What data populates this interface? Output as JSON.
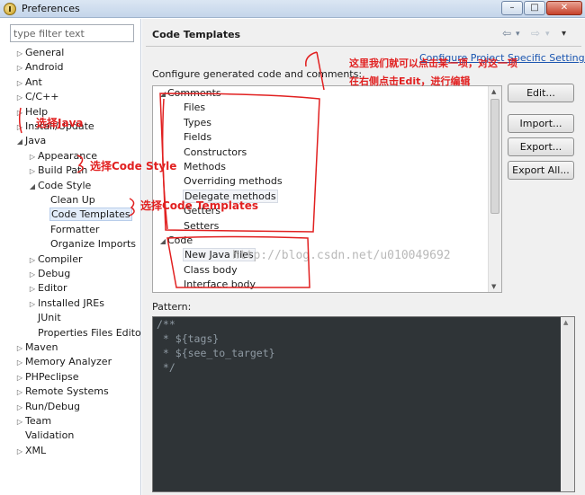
{
  "window": {
    "title": "Preferences",
    "min": "–",
    "max": "□",
    "close": "✕"
  },
  "left": {
    "filter_placeholder": "type filter text",
    "items": [
      {
        "label": "General",
        "arrow": "▷"
      },
      {
        "label": "Android",
        "arrow": "▷"
      },
      {
        "label": "Ant",
        "arrow": "▷"
      },
      {
        "label": "C/C++",
        "arrow": "▷"
      },
      {
        "label": "Help",
        "arrow": "▷"
      },
      {
        "label": "Install/Update",
        "arrow": "▷"
      },
      {
        "label": "Java",
        "arrow": "◢"
      },
      {
        "label": "Appearance",
        "arrow": "▷"
      },
      {
        "label": "Build Path",
        "arrow": "▷"
      },
      {
        "label": "Code Style",
        "arrow": "◢"
      },
      {
        "label": "Clean Up",
        "arrow": ""
      },
      {
        "label": "Code Templates",
        "arrow": ""
      },
      {
        "label": "Formatter",
        "arrow": ""
      },
      {
        "label": "Organize Imports",
        "arrow": ""
      },
      {
        "label": "Compiler",
        "arrow": "▷"
      },
      {
        "label": "Debug",
        "arrow": "▷"
      },
      {
        "label": "Editor",
        "arrow": "▷"
      },
      {
        "label": "Installed JREs",
        "arrow": "▷"
      },
      {
        "label": "JUnit",
        "arrow": ""
      },
      {
        "label": "Properties Files Edito",
        "arrow": ""
      },
      {
        "label": "Maven",
        "arrow": "▷"
      },
      {
        "label": "Memory Analyzer",
        "arrow": "▷"
      },
      {
        "label": "PHPeclipse",
        "arrow": "▷"
      },
      {
        "label": "Remote Systems",
        "arrow": "▷"
      },
      {
        "label": "Run/Debug",
        "arrow": "▷"
      },
      {
        "label": "Team",
        "arrow": "▷"
      },
      {
        "label": "Validation",
        "arrow": ""
      },
      {
        "label": "XML",
        "arrow": "▷"
      }
    ]
  },
  "right": {
    "title": "Code Templates",
    "nav": {
      "back": "⇦",
      "back_menu": "▾",
      "forward": "⇨",
      "forward_menu": "▾",
      "view_menu": "▾"
    },
    "config_link": "Configure Project Specific Settings...",
    "description": "Configure generated code and comments:",
    "templates": [
      {
        "label": "Comments",
        "arrow": "◢"
      },
      {
        "label": "Files",
        "arrow": ""
      },
      {
        "label": "Types",
        "arrow": ""
      },
      {
        "label": "Fields",
        "arrow": ""
      },
      {
        "label": "Constructors",
        "arrow": ""
      },
      {
        "label": "Methods",
        "arrow": ""
      },
      {
        "label": "Overriding methods",
        "arrow": ""
      },
      {
        "label": "Delegate methods",
        "arrow": ""
      },
      {
        "label": "Getters",
        "arrow": ""
      },
      {
        "label": "Setters",
        "arrow": ""
      },
      {
        "label": "Code",
        "arrow": "◢"
      },
      {
        "label": "New Java files",
        "arrow": ""
      },
      {
        "label": "Class body",
        "arrow": ""
      },
      {
        "label": "Interface body",
        "arrow": ""
      }
    ],
    "buttons": {
      "edit": "Edit...",
      "import": "Import...",
      "export": "Export...",
      "export_all": "Export All..."
    },
    "pattern_label": "Pattern:",
    "pattern_code": "/**\n * ${tags}\n * ${see_to_target}\n */"
  },
  "annotations": {
    "select_java": "选择Java",
    "select_code_style": "选择Code Style",
    "select_code_templates": "选择Code Templates",
    "note_line1": "这里我们就可以点击某一项，对这一项",
    "note_line2": "在右侧点击Edit，进行编辑",
    "color": "#e12020"
  },
  "watermark": "http://blog.csdn.net/u010049692"
}
